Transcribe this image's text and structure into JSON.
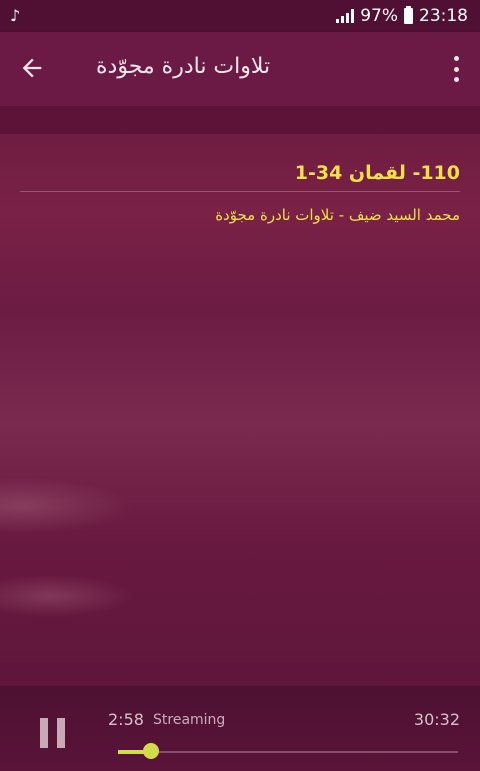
{
  "status_bar": {
    "battery": "97%",
    "time": "23:18",
    "music_icon": "music-note-icon"
  },
  "app_bar": {
    "title": "تلاوات نادرة مجوّدة",
    "back_icon": "arrow-left-icon",
    "menu_icon": "more-vert-icon"
  },
  "track": {
    "title": "110- لقمان 34-1",
    "subtitle": "محمد السيد ضيف - تلاوات نادرة مجوّدة"
  },
  "player": {
    "elapsed": "2:58",
    "status": "Streaming",
    "duration": "30:32",
    "progress": 0.097,
    "accent_color": "#d3dc4a"
  }
}
